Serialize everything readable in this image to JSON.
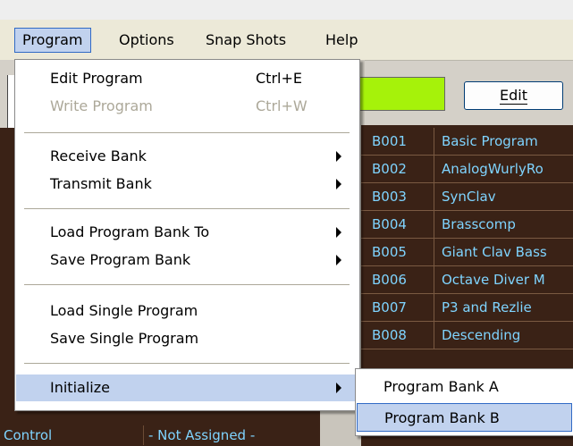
{
  "menubar": {
    "items": [
      {
        "label": "Program",
        "active": true
      },
      {
        "label": "Options",
        "active": false
      },
      {
        "label": "Snap Shots",
        "active": false
      },
      {
        "label": "Help",
        "active": false
      }
    ]
  },
  "program_menu": {
    "edit_program": {
      "label": "Edit Program",
      "shortcut": "Ctrl+E"
    },
    "write_program": {
      "label": "Write Program",
      "shortcut": "Ctrl+W",
      "enabled": false
    },
    "receive_bank": {
      "label": "Receive Bank"
    },
    "transmit_bank": {
      "label": "Transmit Bank"
    },
    "load_program_bank_to": {
      "label": "Load Program Bank To"
    },
    "save_program_bank": {
      "label": "Save Program Bank"
    },
    "load_single_program": {
      "label": "Load Single Program"
    },
    "save_single_program": {
      "label": "Save Single Program"
    },
    "initialize": {
      "label": "Initialize"
    }
  },
  "initialize_submenu": {
    "program_bank_a": "Program Bank A",
    "program_bank_b": "Program Bank B"
  },
  "edit_button": {
    "label": "Edit"
  },
  "colors": {
    "menu_highlight": "#c1d2ee",
    "list_background": "#3a2216",
    "list_text": "#7fd4ff",
    "status_green": "#a6f20a"
  },
  "programs": [
    {
      "number": "B001",
      "name": "Basic Program"
    },
    {
      "number": "B002",
      "name": "AnalogWurlyRo"
    },
    {
      "number": "B003",
      "name": "SynClav"
    },
    {
      "number": "B004",
      "name": "Brasscomp"
    },
    {
      "number": "B005",
      "name": "Giant Clav Bass"
    },
    {
      "number": "B006",
      "name": "Octave Diver M"
    },
    {
      "number": "B007",
      "name": "P3 and Rezlie"
    },
    {
      "number": "B008",
      "name": "Descending"
    }
  ],
  "controls_row": {
    "label": "Control",
    "value": "- Not Assigned -"
  }
}
